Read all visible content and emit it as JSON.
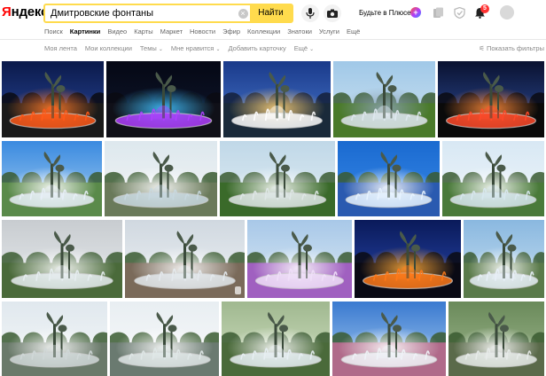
{
  "header": {
    "logo_first": "Я",
    "logo_rest": "ндекс",
    "search_value": "Дмитровские фонтаны",
    "search_button": "Найти",
    "plus_link": "Будьте в Плюсе",
    "plus_badge": "+",
    "notifications_count": "5"
  },
  "services": [
    "Поиск",
    "Картинки",
    "Видео",
    "Карты",
    "Маркет",
    "Новости",
    "Эфир",
    "Коллекции",
    "Знатоки",
    "Услуги",
    "Ещё"
  ],
  "services_active_index": 1,
  "filters": {
    "items": [
      {
        "label": "Моя лента",
        "chevron": ""
      },
      {
        "label": "Мои коллекции",
        "chevron": ""
      },
      {
        "label": "Темы",
        "chevron": "⌄"
      },
      {
        "label": "Мне нравится",
        "chevron": "⌄"
      },
      {
        "label": "Добавить карточку",
        "chevron": ""
      },
      {
        "label": "Ещё",
        "chevron": "⌄"
      }
    ],
    "show_filters": "Показать фильтры"
  },
  "colors": {
    "accent": "#ffdb4d",
    "logo_red": "#ff0000",
    "badge_red": "#ff3333"
  },
  "images": [
    {
      "name": "fountain-night-red",
      "row": 0,
      "theme": "night",
      "sky": [
        "#0b1a4a",
        "#2b4aa0"
      ],
      "water": "#ff5a1a",
      "ground": "#1a1a1a",
      "glow": "#ff7a2a"
    },
    {
      "name": "fountain-night-pool-lights",
      "row": 0,
      "theme": "night",
      "sky": [
        "#050814",
        "#101830"
      ],
      "water": "#b040ff",
      "ground": "#101018",
      "glow": "#40c0ff"
    },
    {
      "name": "fountain-dusk-blue",
      "row": 0,
      "theme": "dusk",
      "sky": [
        "#1a3a8a",
        "#4a7ad0"
      ],
      "water": "#ffffff",
      "ground": "#1a2a3a",
      "glow": "#ffd27a"
    },
    {
      "name": "fountain-park-green",
      "row": 0,
      "theme": "day",
      "sky": [
        "#a0c8e8",
        "#d0e4f0"
      ],
      "water": "#dfe8f0",
      "ground": "#4a7a2a",
      "glow": "#8aa0b0"
    },
    {
      "name": "fountain-night-orange",
      "row": 0,
      "theme": "night",
      "sky": [
        "#0a1230",
        "#3050a0"
      ],
      "water": "#ff4a2a",
      "ground": "#0a0a0a",
      "glow": "#ff8a3a"
    },
    {
      "name": "fountain-day-sculpture",
      "row": 1,
      "theme": "day",
      "sky": [
        "#3a8ae0",
        "#a8d0f0"
      ],
      "water": "#e8f0f8",
      "ground": "#5a8a4a",
      "glow": "#ffffff"
    },
    {
      "name": "fountain-round-trees",
      "row": 1,
      "theme": "day",
      "sky": [
        "#dde8ee",
        "#f4f4f4"
      ],
      "water": "#c8d8e0",
      "ground": "#6a7a5a",
      "glow": "#ffffff"
    },
    {
      "name": "fountain-garden-tiered",
      "row": 1,
      "theme": "day",
      "sky": [
        "#c0d8e8",
        "#e0ecf2"
      ],
      "water": "#e0e8e8",
      "ground": "#3a6a2a",
      "glow": "#ffffff"
    },
    {
      "name": "fountain-blue-water",
      "row": 1,
      "theme": "day",
      "sky": [
        "#1a6ad0",
        "#3a8ae8"
      ],
      "water": "#e8f4ff",
      "ground": "#2a5ab0",
      "glow": "#ffffff"
    },
    {
      "name": "fountain-day-park",
      "row": 1,
      "theme": "day",
      "sky": [
        "#d8e8f4",
        "#f0f6fa"
      ],
      "water": "#d8e8f0",
      "ground": "#4a7a3a",
      "glow": "#ffffff"
    },
    {
      "name": "fountain-cloudy-church",
      "row": 2,
      "theme": "overcast",
      "sky": [
        "#c8ccd0",
        "#e8ecee"
      ],
      "water": "#e8eef2",
      "ground": "#4a6a3a",
      "glow": "#ffffff"
    },
    {
      "name": "fountain-plaza-building",
      "row": 2,
      "theme": "overcast",
      "sky": [
        "#d0d8e0",
        "#eef2f4"
      ],
      "water": "#e4eaee",
      "ground": "#7a6a5a",
      "glow": "#ffffff"
    },
    {
      "name": "fountain-purple-pool",
      "row": 2,
      "theme": "day",
      "sky": [
        "#a8c8e8",
        "#dceaf4"
      ],
      "water": "#f0e0f8",
      "ground": "#a060c0",
      "glow": "#ffffff"
    },
    {
      "name": "fountain-night-tulips",
      "row": 2,
      "theme": "night",
      "sky": [
        "#0a1a5a",
        "#2a4ab0"
      ],
      "water": "#ff7a1a",
      "ground": "#0a0a14",
      "glow": "#ffaa3a"
    },
    {
      "name": "fountain-day-spray",
      "row": 2,
      "theme": "day",
      "sky": [
        "#8ab8e0",
        "#c8e0f0"
      ],
      "water": "#e8f0f8",
      "ground": "#5a7a4a",
      "glow": "#ffffff"
    },
    {
      "name": "fountain-frog-sculptures",
      "row": 3,
      "theme": "day",
      "sky": [
        "#e0e8ee",
        "#f6f8f8"
      ],
      "water": "#d0d8d8",
      "ground": "#6a7a6a",
      "glow": "#ffffff"
    },
    {
      "name": "fountain-frog-closeup",
      "row": 3,
      "theme": "day",
      "sky": [
        "#e8eef2",
        "#fafafa"
      ],
      "water": "#e0e8e8",
      "ground": "#6a7a70",
      "glow": "#ffffff"
    },
    {
      "name": "fountain-round-basin",
      "row": 3,
      "theme": "day",
      "sky": [
        "#a0b890",
        "#d0e0c0"
      ],
      "water": "#e8f0f4",
      "ground": "#4a6a3a",
      "glow": "#ffffff"
    },
    {
      "name": "fountain-clouds-flowers",
      "row": 3,
      "theme": "day",
      "sky": [
        "#3a7ad0",
        "#a8ccf0"
      ],
      "water": "#f0f4f8",
      "ground": "#b06a8a",
      "glow": "#ffffff"
    },
    {
      "name": "fountain-arch-pavilion",
      "row": 3,
      "theme": "day",
      "sky": [
        "#6a8a5a",
        "#a0b890"
      ],
      "water": "#e8ecea",
      "ground": "#5a6a4a",
      "glow": "#ffffff"
    }
  ]
}
